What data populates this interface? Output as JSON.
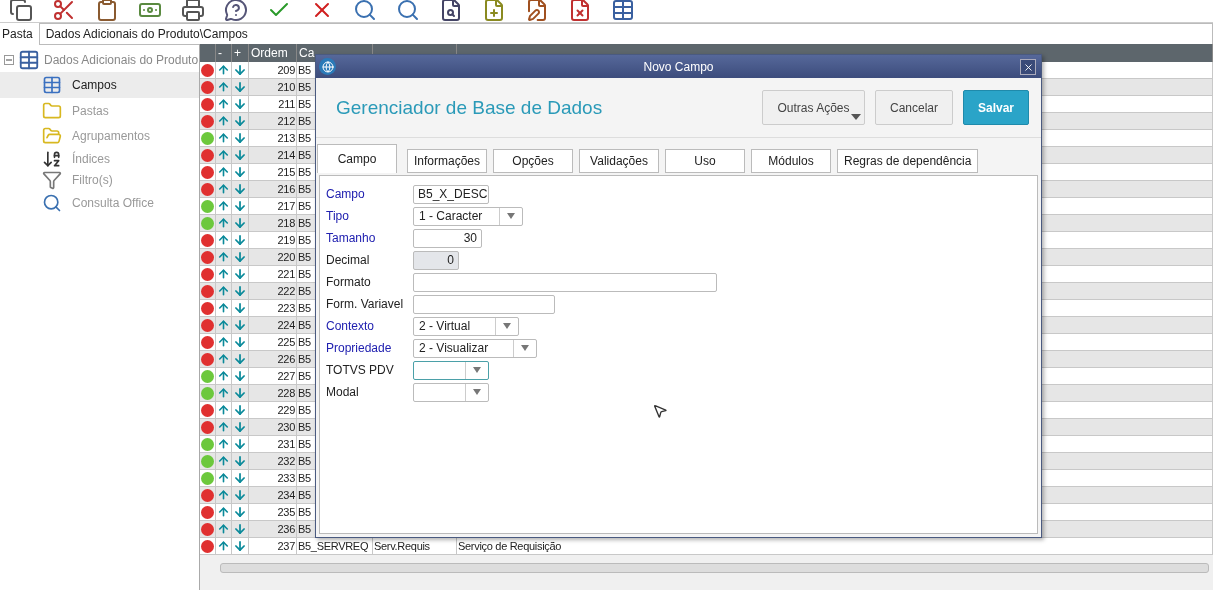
{
  "toolbar": {
    "icons": [
      {
        "kind": "copy"
      },
      {
        "kind": "cut"
      },
      {
        "kind": "paste"
      },
      {
        "kind": "money"
      },
      {
        "kind": "print"
      },
      {
        "kind": "help"
      },
      {
        "kind": "confirm"
      },
      {
        "kind": "cancel"
      },
      {
        "kind": "search"
      },
      {
        "kind": "search"
      },
      {
        "kind": "preview"
      },
      {
        "kind": "add"
      },
      {
        "kind": "edit"
      },
      {
        "kind": "delete"
      },
      {
        "kind": "table"
      }
    ]
  },
  "path": {
    "label": "Pasta",
    "value": "Dados Adicionais do Produto\\Campos"
  },
  "tree": {
    "label": "Dados Adicionais do Produto",
    "expanded": true,
    "children": [
      {
        "label": "Campos",
        "kind": "table",
        "selected": true
      },
      {
        "label": "Pastas",
        "kind": "folder",
        "selected": false
      },
      {
        "label": "Agrupamentos",
        "kind": "folderlines",
        "selected": false
      },
      {
        "label": "Índices",
        "kind": "sort",
        "selected": false
      },
      {
        "label": "Filtro(s)",
        "kind": "filter",
        "selected": false
      },
      {
        "label": "Consulta Office",
        "kind": "search",
        "selected": false
      }
    ]
  },
  "grid": {
    "columns": [
      "-",
      "+",
      "Ordem",
      "Ca"
    ],
    "rows": [
      {
        "order": "209",
        "color": "#e03030",
        "campo": "B5"
      },
      {
        "order": "210",
        "color": "#e03030",
        "campo": "B5"
      },
      {
        "order": "211",
        "color": "#e03030",
        "campo": "B5"
      },
      {
        "order": "212",
        "color": "#e03030",
        "campo": "B5"
      },
      {
        "order": "213",
        "color": "#6cc83c",
        "campo": "B5"
      },
      {
        "order": "214",
        "color": "#e03030",
        "campo": "B5"
      },
      {
        "order": "215",
        "color": "#e03030",
        "campo": "B5"
      },
      {
        "order": "216",
        "color": "#e03030",
        "campo": "B5"
      },
      {
        "order": "217",
        "color": "#6cc83c",
        "campo": "B5"
      },
      {
        "order": "218",
        "color": "#6cc83c",
        "campo": "B5"
      },
      {
        "order": "219",
        "color": "#e03030",
        "campo": "B5"
      },
      {
        "order": "220",
        "color": "#e03030",
        "campo": "B5"
      },
      {
        "order": "221",
        "color": "#e03030",
        "campo": "B5"
      },
      {
        "order": "222",
        "color": "#e03030",
        "campo": "B5"
      },
      {
        "order": "223",
        "color": "#e03030",
        "campo": "B5"
      },
      {
        "order": "224",
        "color": "#e03030",
        "campo": "B5"
      },
      {
        "order": "225",
        "color": "#e03030",
        "campo": "B5"
      },
      {
        "order": "226",
        "color": "#e03030",
        "campo": "B5"
      },
      {
        "order": "227",
        "color": "#6cc83c",
        "campo": "B5"
      },
      {
        "order": "228",
        "color": "#6cc83c",
        "campo": "B5"
      },
      {
        "order": "229",
        "color": "#e03030",
        "campo": "B5"
      },
      {
        "order": "230",
        "color": "#e03030",
        "campo": "B5"
      },
      {
        "order": "231",
        "color": "#6cc83c",
        "campo": "B5"
      },
      {
        "order": "232",
        "color": "#6cc83c",
        "campo": "B5"
      },
      {
        "order": "233",
        "color": "#6cc83c",
        "campo": "B5"
      },
      {
        "order": "234",
        "color": "#e03030",
        "campo": "B5"
      },
      {
        "order": "235",
        "color": "#e03030",
        "campo": "B5"
      },
      {
        "order": "236",
        "color": "#e03030",
        "campo": "B5"
      },
      {
        "order": "237",
        "color": "#e03030",
        "campo": "B5_SERVREQ",
        "titulo": "Serv.Requis",
        "descricao": "Serviço de Requisição"
      }
    ]
  },
  "dialog": {
    "title": "Novo Campo",
    "heading": "Gerenciador de Base de Dados",
    "buttons": [
      {
        "label": "Outras Ações",
        "kind": "menu"
      },
      {
        "label": "Cancelar",
        "kind": "normal"
      },
      {
        "label": "Salvar",
        "kind": "primary"
      }
    ],
    "tabs": [
      {
        "label": "Campo",
        "selected": true
      },
      {
        "label": "Informações",
        "selected": false
      },
      {
        "label": "Opções",
        "selected": false
      },
      {
        "label": "Validações",
        "selected": false
      },
      {
        "label": "Uso",
        "selected": false
      },
      {
        "label": "Módulos",
        "selected": false
      },
      {
        "label": "Regras de dependência",
        "selected": false
      }
    ],
    "fields": [
      {
        "label": "Campo",
        "kind": "text",
        "value": "B5_X_DESC",
        "required": true
      },
      {
        "label": "Tipo",
        "kind": "combo",
        "value": "1 - Caracter",
        "required": true
      },
      {
        "label": "Tamanho",
        "kind": "text",
        "value": "30",
        "required": true
      },
      {
        "label": "Decimal",
        "kind": "text",
        "value": "0",
        "required": false,
        "disabled": true
      },
      {
        "label": "Formato",
        "kind": "text",
        "required": false
      },
      {
        "label": "Form. Variavel",
        "kind": "text",
        "required": false
      },
      {
        "label": "Contexto",
        "kind": "combo",
        "value": "2 - Virtual",
        "required": true
      },
      {
        "label": "Propriedade",
        "kind": "combo",
        "value": "2 - Visualizar",
        "required": true
      },
      {
        "label": "TOTVS PDV",
        "kind": "combo",
        "required": false,
        "focused": true
      },
      {
        "label": "Modal",
        "kind": "combo",
        "required": false
      }
    ]
  }
}
